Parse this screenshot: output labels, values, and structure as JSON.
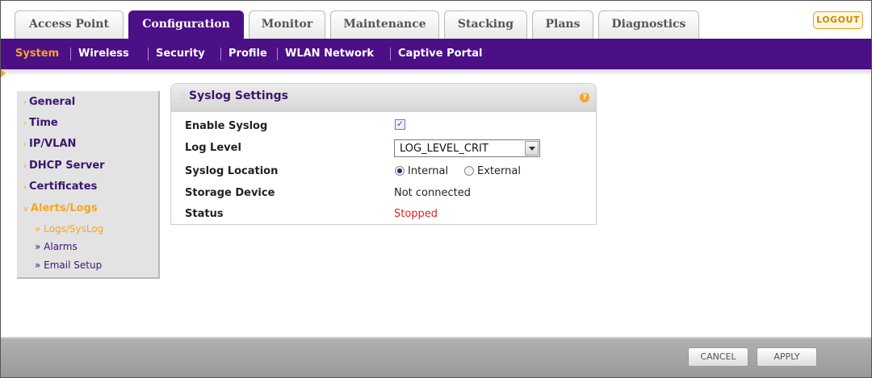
{
  "tabs": [
    {
      "label": "Access Point",
      "active": false
    },
    {
      "label": "Configuration",
      "active": true
    },
    {
      "label": "Monitor",
      "active": false
    },
    {
      "label": "Maintenance",
      "active": false
    },
    {
      "label": "Stacking",
      "active": false
    },
    {
      "label": "Plans",
      "active": false
    },
    {
      "label": "Diagnostics",
      "active": false
    }
  ],
  "logout_label": "LOGOUT",
  "subnav": [
    {
      "label": "System",
      "active": true
    },
    {
      "label": "Wireless",
      "active": false
    },
    {
      "label": "Security",
      "active": false
    },
    {
      "label": "Profile",
      "active": false
    },
    {
      "label": "WLAN Network",
      "active": false
    },
    {
      "label": "Captive Portal",
      "active": false
    }
  ],
  "sidemenu": {
    "items": [
      {
        "label": "General"
      },
      {
        "label": "Time"
      },
      {
        "label": "IP/VLAN"
      },
      {
        "label": "DHCP Server"
      },
      {
        "label": "Certificates"
      },
      {
        "label": "Alerts/Logs",
        "expanded": true
      }
    ],
    "subitems": [
      {
        "label": "» Logs/SysLog",
        "active": true
      },
      {
        "label": "» Alarms",
        "active": false
      },
      {
        "label": "» Email Setup",
        "active": false
      }
    ]
  },
  "panel": {
    "title": "Syslog Settings",
    "help_icon": "question-icon",
    "fields": {
      "enable_syslog": {
        "label": "Enable Syslog",
        "checked": true
      },
      "log_level": {
        "label": "Log Level",
        "value": "LOG_LEVEL_CRIT"
      },
      "syslog_location": {
        "label": "Syslog Location",
        "options": [
          "Internal",
          "External"
        ],
        "selected": "Internal"
      },
      "storage_device": {
        "label": "Storage Device",
        "value": "Not connected"
      },
      "status": {
        "label": "Status",
        "value": "Stopped"
      }
    }
  },
  "footer": {
    "cancel_label": "CANCEL",
    "apply_label": "APPLY"
  },
  "colors": {
    "brand_purple": "#4b0f86",
    "accent_orange": "#f5a623",
    "status_red": "#e02020"
  }
}
